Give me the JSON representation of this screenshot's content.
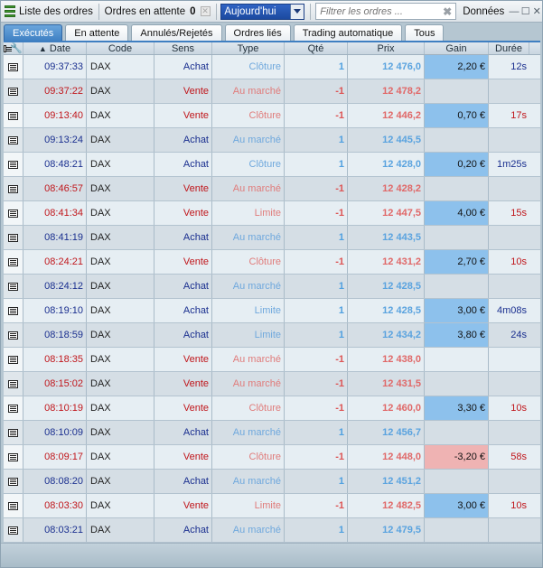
{
  "titlebar": {
    "list_title": "Liste des ordres",
    "pending_label": "Ordres en attente",
    "pending_count": "0",
    "period_selected": "Aujourd'hui",
    "filter_placeholder": "Filtrer les ordres ...",
    "data_label": "Données"
  },
  "tabs": [
    {
      "label": "Exécutés",
      "active": true
    },
    {
      "label": "En attente"
    },
    {
      "label": "Annulés/Rejetés"
    },
    {
      "label": "Ordres liés"
    },
    {
      "label": "Trading automatique"
    },
    {
      "label": "Tous"
    }
  ],
  "columns": {
    "date": "Date",
    "code": "Code",
    "sens": "Sens",
    "type": "Type",
    "qte": "Qté",
    "prix": "Prix",
    "gain": "Gain",
    "duree": "Durée"
  },
  "orders": [
    {
      "time": "09:37:33",
      "code": "DAX",
      "sens": "Achat",
      "type": "Clôture",
      "qte": "1",
      "prix": "12 476,0",
      "gain": "2,20 €",
      "duree": "12s"
    },
    {
      "time": "09:37:22",
      "code": "DAX",
      "sens": "Vente",
      "type": "Au marché",
      "qte": "-1",
      "prix": "12 478,2",
      "gain": "",
      "duree": ""
    },
    {
      "time": "09:13:40",
      "code": "DAX",
      "sens": "Vente",
      "type": "Clôture",
      "qte": "-1",
      "prix": "12 446,2",
      "gain": "0,70 €",
      "duree": "17s"
    },
    {
      "time": "09:13:24",
      "code": "DAX",
      "sens": "Achat",
      "type": "Au marché",
      "qte": "1",
      "prix": "12 445,5",
      "gain": "",
      "duree": ""
    },
    {
      "time": "08:48:21",
      "code": "DAX",
      "sens": "Achat",
      "type": "Clôture",
      "qte": "1",
      "prix": "12 428,0",
      "gain": "0,20 €",
      "duree": "1m25s"
    },
    {
      "time": "08:46:57",
      "code": "DAX",
      "sens": "Vente",
      "type": "Au marché",
      "qte": "-1",
      "prix": "12 428,2",
      "gain": "",
      "duree": ""
    },
    {
      "time": "08:41:34",
      "code": "DAX",
      "sens": "Vente",
      "type": "Limite",
      "qte": "-1",
      "prix": "12 447,5",
      "gain": "4,00 €",
      "duree": "15s"
    },
    {
      "time": "08:41:19",
      "code": "DAX",
      "sens": "Achat",
      "type": "Au marché",
      "qte": "1",
      "prix": "12 443,5",
      "gain": "",
      "duree": ""
    },
    {
      "time": "08:24:21",
      "code": "DAX",
      "sens": "Vente",
      "type": "Clôture",
      "qte": "-1",
      "prix": "12 431,2",
      "gain": "2,70 €",
      "duree": "10s"
    },
    {
      "time": "08:24:12",
      "code": "DAX",
      "sens": "Achat",
      "type": "Au marché",
      "qte": "1",
      "prix": "12 428,5",
      "gain": "",
      "duree": ""
    },
    {
      "time": "08:19:10",
      "code": "DAX",
      "sens": "Achat",
      "type": "Limite",
      "qte": "1",
      "prix": "12 428,5",
      "gain": "3,00 €",
      "duree": "4m08s"
    },
    {
      "time": "08:18:59",
      "code": "DAX",
      "sens": "Achat",
      "type": "Limite",
      "qte": "1",
      "prix": "12 434,2",
      "gain": "3,80 €",
      "duree": "24s"
    },
    {
      "time": "08:18:35",
      "code": "DAX",
      "sens": "Vente",
      "type": "Au marché",
      "qte": "-1",
      "prix": "12 438,0",
      "gain": "",
      "duree": ""
    },
    {
      "time": "08:15:02",
      "code": "DAX",
      "sens": "Vente",
      "type": "Au marché",
      "qte": "-1",
      "prix": "12 431,5",
      "gain": "",
      "duree": ""
    },
    {
      "time": "08:10:19",
      "code": "DAX",
      "sens": "Vente",
      "type": "Clôture",
      "qte": "-1",
      "prix": "12 460,0",
      "gain": "3,30 €",
      "duree": "10s"
    },
    {
      "time": "08:10:09",
      "code": "DAX",
      "sens": "Achat",
      "type": "Au marché",
      "qte": "1",
      "prix": "12 456,7",
      "gain": "",
      "duree": ""
    },
    {
      "time": "08:09:17",
      "code": "DAX",
      "sens": "Vente",
      "type": "Clôture",
      "qte": "-1",
      "prix": "12 448,0",
      "gain": "-3,20 €",
      "duree": "58s"
    },
    {
      "time": "08:08:20",
      "code": "DAX",
      "sens": "Achat",
      "type": "Au marché",
      "qte": "1",
      "prix": "12 451,2",
      "gain": "",
      "duree": ""
    },
    {
      "time": "08:03:30",
      "code": "DAX",
      "sens": "Vente",
      "type": "Limite",
      "qte": "-1",
      "prix": "12 482,5",
      "gain": "3,00 €",
      "duree": "10s"
    },
    {
      "time": "08:03:21",
      "code": "DAX",
      "sens": "Achat",
      "type": "Au marché",
      "qte": "1",
      "prix": "12 479,5",
      "gain": "",
      "duree": ""
    }
  ],
  "colors": {
    "buy": "#1a2f8f",
    "sell": "#c0161b",
    "gain_positive_bg": "#8dc1ec",
    "gain_negative_bg": "#efb3b3",
    "active_tab": "#3d7fc2"
  }
}
